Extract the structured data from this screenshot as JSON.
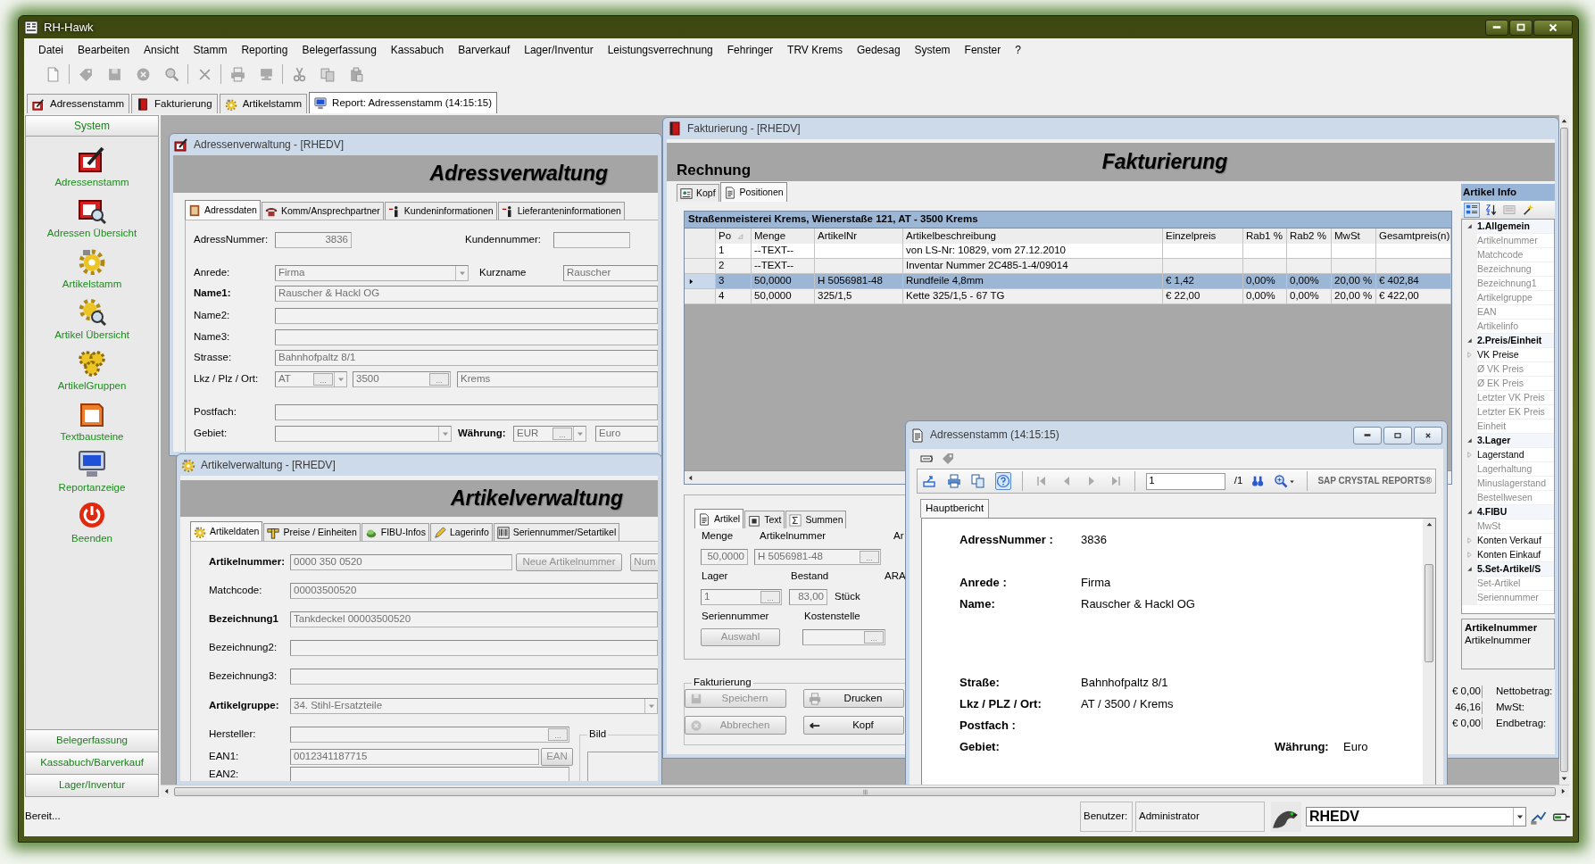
{
  "app": {
    "title": "RH-Hawk"
  },
  "menu": [
    "Datei",
    "Bearbeiten",
    "Ansicht",
    "Stamm",
    "Reporting",
    "Belegerfassung",
    "Kassabuch",
    "Barverkauf",
    "Lager/Inventur",
    "Leistungsverrechnung",
    "Fehringer",
    "TRV Krems",
    "Gedesag",
    "System",
    "Fenster",
    "?"
  ],
  "toolbar": [
    {
      "kind": "page"
    },
    {
      "kind": "separator"
    },
    {
      "kind": "tag"
    },
    {
      "kind": "save"
    },
    {
      "kind": "cancel"
    },
    {
      "kind": "search"
    },
    {
      "kind": "separator"
    },
    {
      "kind": "delete"
    },
    {
      "kind": "separator"
    },
    {
      "kind": "print"
    },
    {
      "kind": "preview"
    },
    {
      "kind": "separator"
    },
    {
      "kind": "cut"
    },
    {
      "kind": "copy"
    },
    {
      "kind": "paste"
    }
  ],
  "doc_tabs": [
    {
      "label": "Adressenstamm",
      "kind": "card_pen",
      "selected": false
    },
    {
      "label": "Fakturierung",
      "kind": "book_red",
      "selected": false
    },
    {
      "label": "Artikelstamm",
      "kind": "gear",
      "selected": false
    },
    {
      "label": "Report: Adressenstamm (14:15:15)",
      "kind": "monitor",
      "selected": true
    }
  ],
  "sidebar": {
    "header": "System",
    "items": [
      {
        "label": "Adressenstamm",
        "kind": "card_pen"
      },
      {
        "label": "Adressen Übersicht",
        "kind": "card_search"
      },
      {
        "label": "Artikelstamm",
        "kind": "gear"
      },
      {
        "label": "Artikel Übersicht",
        "kind": "gear_search"
      },
      {
        "label": "ArtikelGruppen",
        "kind": "gears"
      },
      {
        "label": "Textbausteine",
        "kind": "doc_orange"
      },
      {
        "label": "Reportanzeige",
        "kind": "monitor"
      },
      {
        "label": "Beenden",
        "kind": "power"
      }
    ],
    "groups": [
      "Belegerfassung",
      "Kassabuch/Barverkauf",
      "Lager/Inventur"
    ]
  },
  "address_window": {
    "title": "Adressenverwaltung - [RHEDV]",
    "heading": "Adressverwaltung",
    "tabs": [
      {
        "label": "Adressdaten",
        "kind": "book_brown",
        "selected": true
      },
      {
        "label": "Komm/Ansprechpartner",
        "kind": "phone",
        "selected": false
      },
      {
        "label": "Kundeninformationen",
        "kind": "person",
        "selected": false
      },
      {
        "label": "Lieferanteninformationen",
        "kind": "person",
        "selected": false
      }
    ],
    "fields": [
      {
        "kind": "label",
        "text": "AdressNummer:",
        "bold": false
      },
      {
        "kind": "field",
        "value": "3836"
      },
      {
        "kind": "label",
        "text": "Kundennummer:",
        "bold": false
      },
      {
        "kind": "field"
      },
      {
        "kind": "label",
        "text": "Anrede:",
        "bold": false
      },
      {
        "kind": "combo",
        "value": "Firma"
      },
      {
        "kind": "label",
        "text": "Kurzname",
        "bold": false
      },
      {
        "kind": "field",
        "value": "Rauscher"
      },
      {
        "kind": "label",
        "text": "Name1:",
        "bold": true
      },
      {
        "kind": "field",
        "value": "Rauscher & Hackl OG"
      },
      {
        "kind": "label",
        "text": "Name2:",
        "bold": false
      },
      {
        "kind": "field"
      },
      {
        "kind": "label",
        "text": "Name3:",
        "bold": false
      },
      {
        "kind": "field"
      },
      {
        "kind": "label",
        "text": "Strasse:",
        "bold": false
      },
      {
        "kind": "field",
        "value": "Bahnhofpaltz 8/1"
      },
      {
        "kind": "label",
        "text": "Lkz / Plz / Ort:",
        "bold": false
      },
      {
        "kind": "lookup_combo",
        "value": "AT",
        "button": "..."
      },
      {
        "kind": "lookup",
        "value": "3500",
        "button": "..."
      },
      {
        "kind": "field",
        "value": "Krems"
      },
      {
        "kind": "label",
        "text": "Postfach:",
        "bold": false
      },
      {
        "kind": "field"
      },
      {
        "kind": "label",
        "text": "Gebiet:",
        "bold": false
      },
      {
        "kind": "combo"
      },
      {
        "kind": "label",
        "text": "Währung:",
        "bold": true
      },
      {
        "kind": "lookup_combo",
        "value": "EUR",
        "button": "..."
      },
      {
        "kind": "field",
        "value": "Euro"
      }
    ]
  },
  "article_window": {
    "title": "Artikelverwaltung - [RHEDV]",
    "heading": "Artikelverwaltung",
    "tabs": [
      {
        "label": "Artikeldaten",
        "kind": "gear",
        "selected": true
      },
      {
        "label": "Preise / Einheiten",
        "kind": "ruler",
        "selected": false
      },
      {
        "label": "FIBU-Infos",
        "kind": "money",
        "selected": false
      },
      {
        "label": "Lagerinfo",
        "kind": "pencil",
        "selected": false
      },
      {
        "label": "Seriennummer/Setartikel",
        "kind": "barcode",
        "selected": false
      }
    ],
    "fields": [
      {
        "kind": "label",
        "text": "Artikelnummer:",
        "bold": true
      },
      {
        "kind": "field",
        "value": "0000 350 0520"
      },
      {
        "kind": "button",
        "text": "Neue Artikelnummer",
        "disabled": true
      },
      {
        "kind": "button",
        "text": "Num",
        "disabled": true
      },
      {
        "kind": "label",
        "text": "Matchcode:",
        "bold": false
      },
      {
        "kind": "field",
        "value": "00003500520"
      },
      {
        "kind": "label",
        "text": "Bezeichnung1",
        "bold": true
      },
      {
        "kind": "field",
        "value": "Tankdeckel 00003500520"
      },
      {
        "kind": "label",
        "text": "Bezeichnung2:",
        "bold": false
      },
      {
        "kind": "field"
      },
      {
        "kind": "label",
        "text": "Bezeichnung3:",
        "bold": false
      },
      {
        "kind": "field"
      },
      {
        "kind": "label",
        "text": "Artikelgruppe:",
        "bold": true
      },
      {
        "kind": "combo",
        "value": "34. Stihl-Ersatzteile"
      },
      {
        "kind": "label",
        "text": "Hersteller:",
        "bold": false
      },
      {
        "kind": "lookup",
        "button": "..."
      },
      {
        "kind": "group",
        "text": "Bild"
      },
      {
        "kind": "label",
        "text": "EAN1:",
        "bold": false
      },
      {
        "kind": "field",
        "value": "0012341187715"
      },
      {
        "kind": "button",
        "text": "EAN",
        "disabled": true
      },
      {
        "kind": "label",
        "text": "EAN2:",
        "bold": false
      },
      {
        "kind": "field"
      }
    ]
  },
  "invoice_window": {
    "title": "Fakturierung - [RHEDV]",
    "document_type": "Rechnung",
    "heading": "Fakturierung",
    "tabs": [
      {
        "label": "Kopf",
        "kind": "head_card",
        "selected": false
      },
      {
        "label": "Positionen",
        "kind": "document",
        "selected": true
      }
    ],
    "grid": {
      "caption": "Straßenmeisterei Krems, Wienerstaße 121, AT - 3500 Krems",
      "columns": [
        {
          "label": "Po",
          "sorted": true
        },
        {
          "label": "Menge",
          "sorted": false
        },
        {
          "label": "ArtikelNr",
          "sorted": false
        },
        {
          "label": "Artikelbeschreibung",
          "sorted": false
        },
        {
          "label": "Einzelpreis",
          "sorted": false
        },
        {
          "label": "Rab1 %",
          "sorted": false
        },
        {
          "label": "Rab2 %",
          "sorted": false
        },
        {
          "label": "MwSt",
          "sorted": false
        },
        {
          "label": "Gesamtpreis(n)",
          "sorted": false
        }
      ],
      "rows": [
        {
          "po": "1",
          "menge": "--TEXT--",
          "beschreibung": "von LS-Nr: 10829, vom 27.12.2010",
          "selected": false
        },
        {
          "po": "2",
          "menge": "--TEXT--",
          "beschreibung": "Inventar Nummer 2C485-1-4/09014",
          "selected": false
        },
        {
          "po": "3",
          "menge": "50,0000",
          "artikelnr": "H 5056981-48",
          "beschreibung": "Rundfeile 4,8mm",
          "einzelpreis": "€ 1,42",
          "rab1": "0,00%",
          "rab2": "0,00%",
          "mwst": "20,00 %",
          "gesamtpreis": "€ 402,84",
          "selected": true
        },
        {
          "po": "4",
          "menge": "50,0000",
          "artikelnr": "325/1,5",
          "beschreibung": "Kette 325/1,5 - 67 TG",
          "einzelpreis": "€ 22,00",
          "rab1": "0,00%",
          "rab2": "0,00%",
          "mwst": "20,00 %",
          "gesamtpreis": "€ 422,00",
          "selected": false
        }
      ]
    },
    "item_panel": {
      "tabs": [
        {
          "label": "Artikel",
          "kind": "document",
          "selected": true
        },
        {
          "label": "Text",
          "kind": "notepad",
          "selected": false
        },
        {
          "label": "Summen",
          "kind": "sigma",
          "selected": false
        }
      ],
      "fields": [
        {
          "kind": "label",
          "text": "Menge",
          "bold": false
        },
        {
          "kind": "label",
          "text": "Artikelnummer",
          "bold": false
        },
        {
          "kind": "label",
          "text": "Ar",
          "bold": false
        },
        {
          "kind": "field",
          "value": "50,0000"
        },
        {
          "kind": "lookup",
          "value": "H 5056981-48",
          "button": "..."
        },
        {
          "kind": "label",
          "text": "Lager",
          "bold": false
        },
        {
          "kind": "label",
          "text": "Bestand",
          "bold": false
        },
        {
          "kind": "label",
          "text": "ARA",
          "bold": false
        },
        {
          "kind": "lookup",
          "value": "1",
          "button": "..."
        },
        {
          "kind": "field",
          "value": "83,00"
        },
        {
          "kind": "label",
          "text": "Stück",
          "bold": false
        },
        {
          "kind": "label",
          "text": "Seriennummer",
          "bold": false
        },
        {
          "kind": "label",
          "text": "Kostenstelle",
          "bold": false
        },
        {
          "kind": "button",
          "text": "Auswahl",
          "disabled": true
        },
        {
          "kind": "lookup",
          "button": "..."
        }
      ]
    },
    "actions": {
      "title": "Fakturierung",
      "buttons": [
        {
          "label": "Speichern",
          "kind": "save",
          "disabled": true
        },
        {
          "label": "Drucken",
          "kind": "print",
          "disabled": false
        },
        {
          "label": "Abbrechen",
          "kind": "cancel",
          "disabled": true
        },
        {
          "label": "Kopf",
          "kind": "arrow_left",
          "disabled": false
        }
      ]
    },
    "info_panel": {
      "title": "Artikel Info",
      "toolbar": [
        {
          "kind": "categorized",
          "selected": true
        },
        {
          "kind": "alphabetical",
          "selected": false
        },
        {
          "kind": "pages",
          "selected": false
        },
        {
          "kind": "wizard",
          "selected": false
        }
      ],
      "tree": [
        {
          "label": "1.Allgemein",
          "expanded": true,
          "children": [
            {
              "label": "Artikelnummer",
              "kind": "leaf"
            },
            {
              "label": "Matchcode",
              "kind": "leaf"
            },
            {
              "label": "Bezeichnung",
              "kind": "leaf"
            },
            {
              "label": "Bezeichnung1",
              "kind": "leaf"
            },
            {
              "label": "Artikelgruppe",
              "kind": "leaf"
            },
            {
              "label": "EAN",
              "kind": "leaf"
            },
            {
              "label": "Artikelinfo",
              "kind": "leaf"
            }
          ]
        },
        {
          "label": "2.Preis/Einheit",
          "expanded": true,
          "children": [
            {
              "label": "VK Preise",
              "kind": "group"
            },
            {
              "label": "Ø VK Preis",
              "kind": "leaf"
            },
            {
              "label": "Ø EK Preis",
              "kind": "leaf"
            },
            {
              "label": "Letzter VK Preis",
              "kind": "leaf"
            },
            {
              "label": "Letzter EK Preis",
              "kind": "leaf"
            },
            {
              "label": "Einheit",
              "kind": "leaf"
            }
          ]
        },
        {
          "label": "3.Lager",
          "expanded": true,
          "children": [
            {
              "label": "Lagerstand",
              "kind": "group"
            },
            {
              "label": "Lagerhaltung",
              "kind": "leaf"
            },
            {
              "label": "Minuslagerstand",
              "kind": "leaf"
            },
            {
              "label": "Bestellwesen",
              "kind": "leaf"
            }
          ]
        },
        {
          "label": "4.FIBU",
          "expanded": true,
          "children": [
            {
              "label": "MwSt",
              "kind": "leaf"
            },
            {
              "label": "Konten Verkauf",
              "kind": "group"
            },
            {
              "label": "Konten Einkauf",
              "kind": "group"
            }
          ]
        },
        {
          "label": "5.Set-Artikel/S",
          "expanded": true,
          "children": [
            {
              "label": "Set-Artikel",
              "kind": "leaf"
            },
            {
              "label": "Seriennummer",
              "kind": "leaf"
            }
          ]
        }
      ],
      "description": {
        "title": "Artikelnummer",
        "text": "Artikelnummer"
      }
    },
    "totals": [
      {
        "value": "€ 0,00",
        "label": "Nettobetrag:"
      },
      {
        "value": "46,16",
        "label": "MwSt:"
      },
      {
        "value": "€ 0,00",
        "label": "Endbetrag:"
      }
    ]
  },
  "report_window": {
    "title": "Adressenstamm (14:15:15)",
    "toolbar": [
      {
        "kind": "export",
        "selected": false
      },
      {
        "kind": "print_blue",
        "selected": false
      },
      {
        "kind": "copy_blue",
        "selected": false
      },
      {
        "kind": "help",
        "selected": true
      },
      {
        "kind": "first",
        "selected": false
      },
      {
        "kind": "prev",
        "selected": false
      },
      {
        "kind": "next",
        "selected": false
      },
      {
        "kind": "last",
        "selected": false
      }
    ],
    "page": "1",
    "page_count": "/1",
    "brand": "SAP CRYSTAL REPORTS®",
    "tab": "Hauptbericht",
    "fields": [
      {
        "label": "AdressNummer :",
        "value": "3836"
      },
      {
        "label": "Anrede :",
        "value": "Firma"
      },
      {
        "label": "Name:",
        "value": "Rauscher & Hackl OG"
      },
      {
        "label": "Straße:",
        "value": "Bahnhofpaltz 8/1"
      },
      {
        "label": "Lkz / PLZ / Ort:",
        "value": "AT / 3500 / Krems"
      },
      {
        "label": "Postfach :"
      },
      {
        "label": "Gebiet:",
        "extra_label": "Währung:",
        "extra_value": "Euro"
      }
    ]
  },
  "status_bar": {
    "text": "Bereit...",
    "user_label": "Benutzer:",
    "user": "Administrator",
    "database": "RHEDV"
  }
}
